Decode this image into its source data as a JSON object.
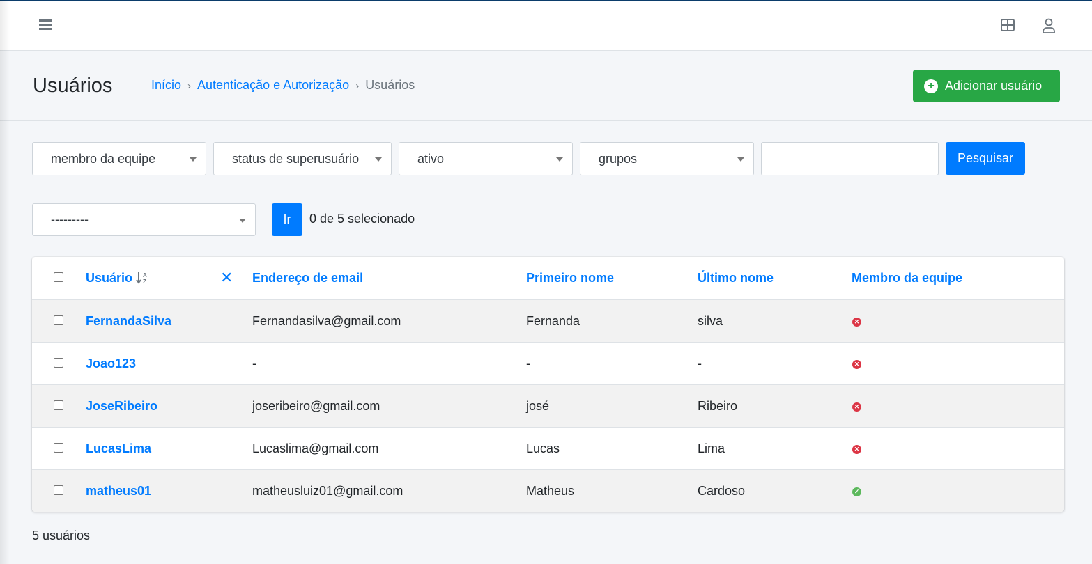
{
  "header": {
    "menu_icon": "hamburger-icon",
    "grid_icon": "grid-icon",
    "user_icon": "user-icon"
  },
  "page": {
    "title": "Usuários",
    "breadcrumb": [
      "Início",
      "Autenticação e Autorização",
      "Usuários"
    ],
    "add_button": "Adicionar usuário"
  },
  "filters": {
    "staff": "membro da equipe",
    "superuser": "status de superusuário",
    "active": "ativo",
    "groups": "grupos",
    "search_value": "",
    "search_button": "Pesquisar"
  },
  "actions": {
    "action_select": "---------",
    "go_button": "Ir",
    "selection_count": "0 de 5 selecionado"
  },
  "table": {
    "headers": [
      "Usuário",
      "Endereço de email",
      "Primeiro nome",
      "Último nome",
      "Membro da equipe"
    ],
    "rows": [
      {
        "username": "FernandaSilva",
        "email": "Fernandasilva@gmail.com",
        "first": "Fernanda",
        "last": "silva",
        "staff": false
      },
      {
        "username": "Joao123",
        "email": "-",
        "first": "-",
        "last": "-",
        "staff": false
      },
      {
        "username": "JoseRibeiro",
        "email": "joseribeiro@gmail.com",
        "first": "josé",
        "last": "Ribeiro",
        "staff": false
      },
      {
        "username": "LucasLima",
        "email": "Lucaslima@gmail.com",
        "first": "Lucas",
        "last": "Lima",
        "staff": false
      },
      {
        "username": "matheus01",
        "email": "matheusluiz01@gmail.com",
        "first": "Matheus",
        "last": "Cardoso",
        "staff": true
      }
    ]
  },
  "footer": {
    "count": "5 usuários"
  },
  "colors": {
    "primary": "#007bff",
    "success": "#28a745",
    "danger": "#dc3545",
    "topbar": "#0b3d6b"
  }
}
